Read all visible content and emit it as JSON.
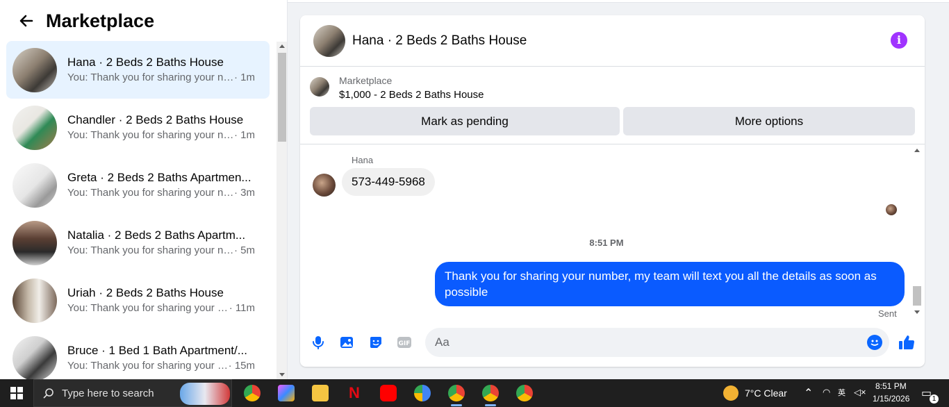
{
  "left_panel": {
    "title": "Marketplace",
    "conversations": [
      {
        "name": "Hana · 2 Beds 2 Baths House",
        "preview": "You: Thank you for sharing your nu...",
        "time": "· 1m",
        "active": true
      },
      {
        "name": "Chandler · 2 Beds 2 Baths House",
        "preview": "You: Thank you for sharing your nu...",
        "time": "· 1m",
        "active": false
      },
      {
        "name": "Greta · 2 Beds 2 Baths Apartmen...",
        "preview": "You: Thank you for sharing your nu...",
        "time": "· 3m",
        "active": false
      },
      {
        "name": "Natalia · 2 Beds 2 Baths Apartm...",
        "preview": "You: Thank you for sharing your nu...",
        "time": "· 5m",
        "active": false
      },
      {
        "name": "Uriah · 2 Beds 2 Baths House",
        "preview": "You: Thank you for sharing your n...",
        "time": "· 11m",
        "active": false
      },
      {
        "name": "Bruce · 1 Bed 1 Bath Apartment/...",
        "preview": "You: Thank you for sharing your n...",
        "time": "· 15m",
        "active": false
      }
    ]
  },
  "chat": {
    "title": "Hana · 2 Beds 2 Baths House",
    "marketplace_label": "Marketplace",
    "listing": "$1,000 - 2 Beds 2 Baths House",
    "mark_pending": "Mark as pending",
    "more_options": "More options",
    "sender_name": "Hana",
    "incoming_message": "573-449-5968",
    "timestamp": "8:51 PM",
    "outgoing_message": "Thank you for  sharing your number, my team will text you all the details as soon as possible",
    "sent_label": "Sent",
    "composer_placeholder": "Aa"
  },
  "taskbar": {
    "search_placeholder": "Type here to search",
    "weather": "7°C  Clear",
    "time": "8:51 PM",
    "date": "1/15/2026",
    "notification_count": "1"
  },
  "colors": {
    "accent": "#0a5bff",
    "active_conversation": "#e7f3ff",
    "info_icon": "#a033ff"
  }
}
